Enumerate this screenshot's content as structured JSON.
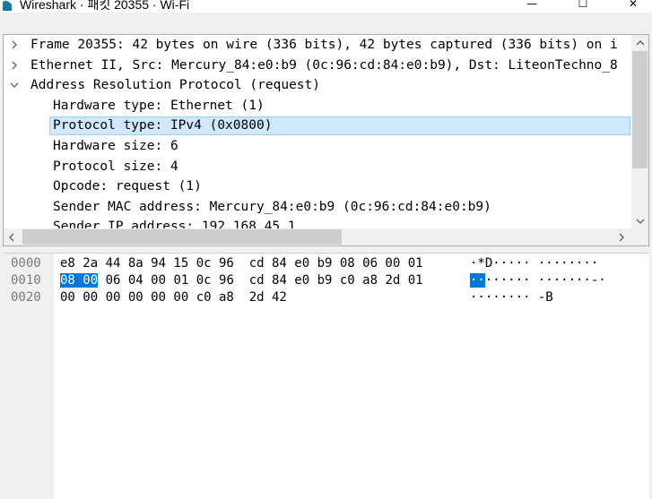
{
  "window": {
    "title": "Wireshark · 패킷 20355 · Wi-Fi",
    "minimize": "—",
    "maximize": "☐",
    "close": "✕"
  },
  "details": {
    "rows": [
      {
        "text": "Frame 20355: 42 bytes on wire (336 bits), 42 bytes captured (336 bits) on i",
        "state": "collapsed"
      },
      {
        "text": "Ethernet II, Src: Mercury_84:e0:b9 (0c:96:cd:84:e0:b9), Dst: LiteonTechno_8",
        "state": "collapsed"
      },
      {
        "text": "Address Resolution Protocol (request)",
        "state": "expanded"
      },
      {
        "text": "Hardware type: Ethernet (1)",
        "state": "child"
      },
      {
        "text": "Protocol type: IPv4 (0x0800)",
        "state": "child-selected"
      },
      {
        "text": "Hardware size: 6",
        "state": "child"
      },
      {
        "text": "Protocol size: 4",
        "state": "child"
      },
      {
        "text": "Opcode: request (1)",
        "state": "child"
      },
      {
        "text": "Sender MAC address: Mercury_84:e0:b9 (0c:96:cd:84:e0:b9)",
        "state": "child"
      },
      {
        "text": "Sender IP address: 192.168.45.1",
        "state": "child"
      }
    ]
  },
  "bytes": {
    "rows": [
      {
        "offset": "0000",
        "hex_pre": "",
        "hex_hl": "",
        "hex_post": "e8 2a 44 8a 94 15 0c 96  cd 84 e0 b9 08 06 00 01",
        "ascii_pre": "",
        "ascii_hl": "",
        "ascii_post": "·*D····· ········"
      },
      {
        "offset": "0010",
        "hex_pre": "",
        "hex_hl": "08 00",
        "hex_post": " 06 04 00 01 0c 96  cd 84 e0 b9 c0 a8 2d 01",
        "ascii_pre": "",
        "ascii_hl": "··",
        "ascii_post": "······ ·······-·"
      },
      {
        "offset": "0020",
        "hex_pre": "",
        "hex_hl": "",
        "hex_post": "00 00 00 00 00 00 c0 a8  2d 42",
        "ascii_pre": "",
        "ascii_hl": "",
        "ascii_post": "········ -B"
      }
    ]
  },
  "colors": {
    "selection_bg": "#cde8ff",
    "selection_border": "#99d1ff",
    "hex_highlight": "#0078d7",
    "offset_text": "#7a7a7a"
  }
}
